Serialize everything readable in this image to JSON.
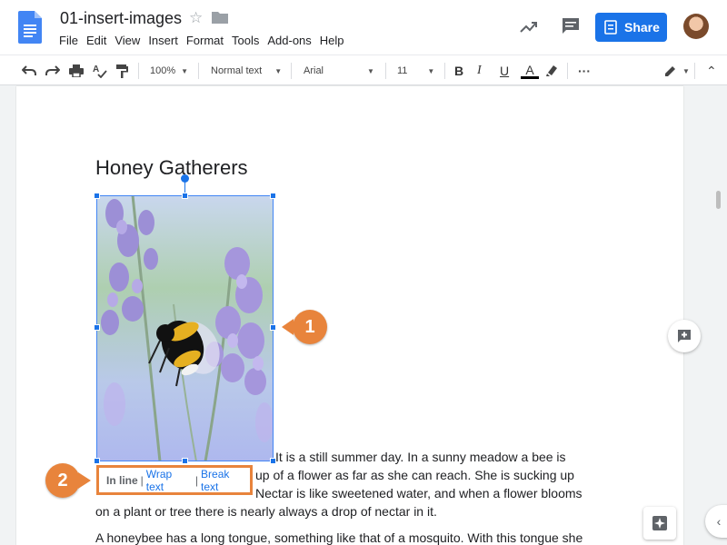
{
  "doc": {
    "title": "01-insert-images"
  },
  "menu": [
    "File",
    "Edit",
    "View",
    "Insert",
    "Format",
    "Tools",
    "Add-ons",
    "Help"
  ],
  "share_label": "Share",
  "toolbar": {
    "zoom": "100%",
    "style": "Normal text",
    "font": "Arial",
    "size": "11"
  },
  "icons": {
    "doc": "docs-logo-icon",
    "star": "star-icon",
    "folder": "folder-icon",
    "activity": "activity-trend-icon",
    "comment": "comment-icon",
    "undo": "undo-icon",
    "redo": "redo-icon",
    "print": "print-icon",
    "spell": "spellcheck-icon",
    "paint": "paint-format-icon",
    "bold": "bold-icon",
    "italic": "italic-icon",
    "underline": "underline-icon",
    "text_color": "text-color-icon",
    "highlight": "highlight-icon",
    "more": "more-icon",
    "edit_mode": "editing-mode-icon",
    "collapse": "chevron-up-icon",
    "add_comment": "add-comment-icon",
    "explore": "explore-icon"
  },
  "colors": {
    "accent": "#1a73e8",
    "callout": "#e8843c",
    "text_color_underline": "#000000"
  },
  "content": {
    "heading": "Honey Gatherers",
    "paragraph1_lines": [
      "It is a still summer day. In a sunny meadow a bee is",
      "up of a flower as far as she can reach. She is sucking up",
      "Nectar is like sweetened water, and when a flower blooms",
      "on a plant or tree there is nearly always a drop of nectar in it."
    ],
    "paragraph2_line": "A honeybee has a long tongue, something like that of a mosquito. With this tongue she"
  },
  "image_options": {
    "inline": "In line",
    "wrap": "Wrap text",
    "break": "Break text",
    "separator": "|"
  },
  "callouts": [
    "1",
    "2"
  ],
  "side_toggle": "‹",
  "toolbar_glyphs": {
    "bold": "B",
    "italic": "I",
    "underline": "U",
    "text_color": "A",
    "more": "···",
    "star": "☆",
    "collapse": "⌃"
  }
}
